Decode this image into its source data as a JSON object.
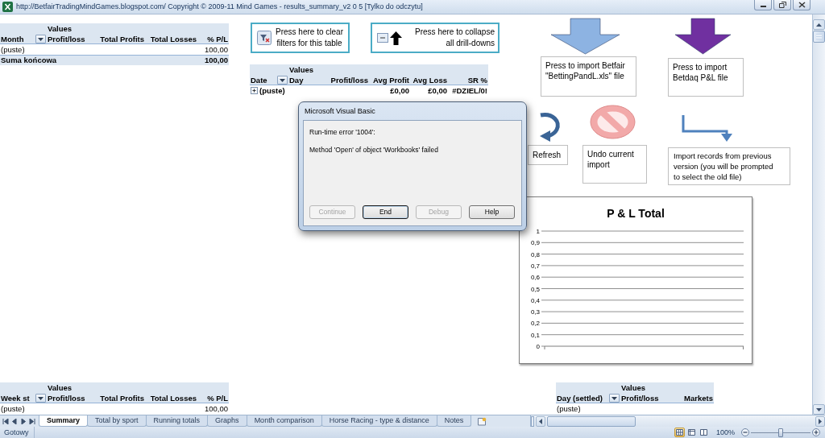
{
  "window": {
    "title": "http://BetfairTradingMindGames.blogspot.com/ Copyright © 2009-11 Mind Games - results_summary_v2 0 5  [Tylko do odczytu]"
  },
  "pivot_tables": [
    {
      "values_header": "Values",
      "columns": [
        {
          "label": "Month",
          "filter": true
        },
        {
          "label": "Profit/loss",
          "filter": false
        },
        {
          "label": "Total Profits",
          "filter": false
        },
        {
          "label": "Total Losses",
          "filter": false
        },
        {
          "label": "% P/L",
          "filter": false
        }
      ],
      "rows": [
        {
          "kind": "item",
          "cells": [
            "(puste)",
            null,
            null,
            null,
            "100,00"
          ]
        },
        {
          "kind": "total",
          "cells": [
            "Suma końcowa",
            null,
            null,
            null,
            "100,00"
          ]
        }
      ]
    },
    {
      "values_header": "Values",
      "columns": [
        {
          "label": "Date",
          "filter": true
        },
        {
          "label": "Day",
          "filter": false
        },
        {
          "label": "Profit/loss",
          "filter": false
        },
        {
          "label": "Avg Profit",
          "filter": false
        },
        {
          "label": "Avg Loss",
          "filter": false
        },
        {
          "label": "SR %",
          "filter": false
        }
      ],
      "rows": [
        {
          "kind": "group",
          "expanded": false,
          "cells": [
            "(puste)",
            null,
            null,
            "£0,00",
            "£0,00",
            "#DZIEL/0!"
          ]
        }
      ]
    },
    {
      "values_header": "Values",
      "columns": [
        {
          "label": "Week st",
          "filter": true
        },
        {
          "label": "Profit/loss",
          "filter": false
        },
        {
          "label": "Total Profits",
          "filter": false
        },
        {
          "label": "Total Losses",
          "filter": false
        },
        {
          "label": "% P/L",
          "filter": false
        }
      ],
      "rows": [
        {
          "kind": "item",
          "cells": [
            "(puste)",
            null,
            null,
            null,
            "100,00"
          ]
        }
      ]
    },
    {
      "values_header": "Values",
      "columns": [
        {
          "label": "Day (settled)",
          "filter": true
        },
        {
          "label": "Profit/loss",
          "filter": false
        },
        {
          "label": "Markets",
          "filter": false
        }
      ],
      "rows": [
        {
          "kind": "item",
          "cells": [
            "(puste)",
            null,
            null
          ]
        }
      ]
    }
  ],
  "sheet_buttons": [
    {
      "kind": "clear_filters",
      "label": "Press here to clear filters for this table"
    },
    {
      "kind": "collapse_all",
      "label": "Press here to collapse all drill-downs"
    }
  ],
  "import_actions": [
    {
      "kind": "down_arrow",
      "color": "#8db3e2",
      "label": "Press to import Betfair \"BettingPandL.xls\" file"
    },
    {
      "kind": "down_arrow",
      "color": "#7030a0",
      "label": "Press to import Betdaq P&L file"
    },
    {
      "kind": "refresh",
      "label": "Refresh"
    },
    {
      "kind": "no_sign",
      "label": "Undo current import"
    },
    {
      "kind": "bent_arrow",
      "label": "Import records from previous version (you will be prompted to select the old file)"
    }
  ],
  "chart": {
    "chart_data": {
      "type": "line",
      "title": "P & L Total",
      "categories": [
        null
      ],
      "ylim": [
        0,
        1
      ],
      "yticks": [
        {
          "value": 0,
          "label": "0"
        },
        {
          "value": 0.1,
          "label": "0,1"
        },
        {
          "value": 0.2,
          "label": "0,2"
        },
        {
          "value": 0.3,
          "label": "0,3"
        },
        {
          "value": 0.4,
          "label": "0,4"
        },
        {
          "value": 0.5,
          "label": "0,5"
        },
        {
          "value": 0.6,
          "label": "0,6"
        },
        {
          "value": 0.7,
          "label": "0,7"
        },
        {
          "value": 0.8,
          "label": "0,8"
        },
        {
          "value": 0.9,
          "label": "0,9"
        },
        {
          "value": 1,
          "label": "1"
        }
      ],
      "grid": true
    }
  },
  "dialog": {
    "title": "Microsoft Visual Basic",
    "messages": [
      "Run-time error '1004':",
      "Method 'Open' of object 'Workbooks' failed"
    ],
    "buttons": [
      {
        "label": "Continue",
        "disabled": true,
        "focused": false
      },
      {
        "label": "End",
        "disabled": false,
        "focused": true
      },
      {
        "label": "Debug",
        "disabled": true,
        "focused": false
      },
      {
        "label": "Help",
        "disabled": false,
        "focused": false
      }
    ]
  },
  "sheet_tabs": [
    {
      "label": "Summary",
      "selected": true
    },
    {
      "label": "Total by sport",
      "selected": false
    },
    {
      "label": "Running totals",
      "selected": false
    },
    {
      "label": "Graphs",
      "selected": false
    },
    {
      "label": "Month comparison",
      "selected": false
    },
    {
      "label": "Horse Racing - type & distance",
      "selected": false
    },
    {
      "label": "Notes",
      "selected": false
    }
  ],
  "status_bar": {
    "status": "Gotowy",
    "view_buttons": [
      {
        "kind": "normal",
        "selected": true
      },
      {
        "kind": "page_layout",
        "selected": false
      },
      {
        "kind": "page_break",
        "selected": false
      }
    ],
    "zoom": "100%",
    "zoom_slider": {
      "level": 0.5
    }
  }
}
